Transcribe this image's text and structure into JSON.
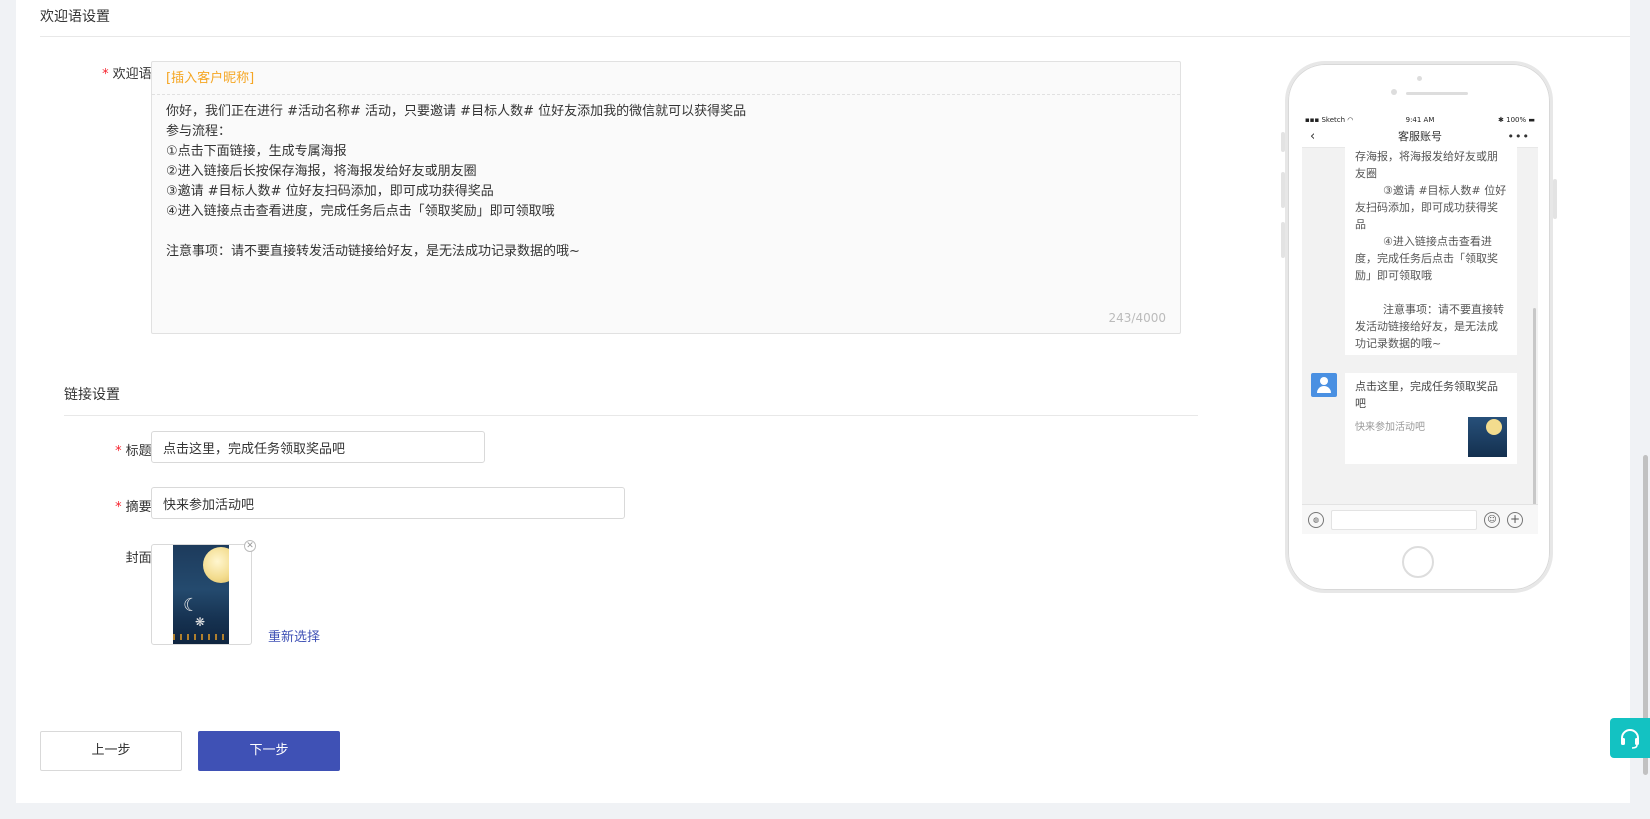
{
  "welcome_section": {
    "title": "欢迎语设置",
    "label": "欢迎语:",
    "required_mark": "*",
    "insert_nickname": "[插入客户昵称]",
    "lines": [
      "你好，我们正在进行 #活动名称# 活动，只要邀请 #目标人数# 位好友添加我的微信就可以获得奖品",
      "参与流程：",
      "①点击下面链接，生成专属海报",
      "②进入链接后长按保存海报，将海报发给好友或朋友圈",
      "③邀请 #目标人数# 位好友扫码添加，即可成功获得奖品",
      "④进入链接点击查看进度，完成任务后点击「领取奖励」即可领取哦",
      "",
      "注意事项：请不要直接转发活动链接给好友，是无法成功记录数据的哦~"
    ],
    "counter": "243/4000"
  },
  "link_section": {
    "title": "链接设置",
    "title_label": "标题:",
    "title_value": "点击这里，完成任务领取奖品吧",
    "summary_label": "摘要:",
    "summary_value": "快来参加活动吧",
    "cover_label": "封面:",
    "reselect": "重新选择",
    "required_mark": "*"
  },
  "buttons": {
    "prev": "上一步",
    "next": "下一步"
  },
  "phone_preview": {
    "status_left": "Sketch",
    "status_time": "9:41 AM",
    "status_right": "100%",
    "nav_title": "客服账号",
    "nav_more": "•••",
    "bubble_lines": [
      "存海报，将海报发给好友或朋友圈",
      "        ③邀请 #目标人数# 位好友扫码添加，即可成功获得奖品",
      "        ④进入链接点击查看进度，完成任务后点击「领取奖励」即可领取哦",
      "",
      "        注意事项：请不要直接转发活动链接给好友，是无法成功记录数据的哦~"
    ],
    "card_title": "点击这里，完成任务领取奖品吧",
    "card_desc": "快来参加活动吧"
  },
  "colors": {
    "primary": "#3f51b5",
    "required": "#f5222d",
    "insert_link": "#f5a623",
    "support": "#13c2c2"
  }
}
